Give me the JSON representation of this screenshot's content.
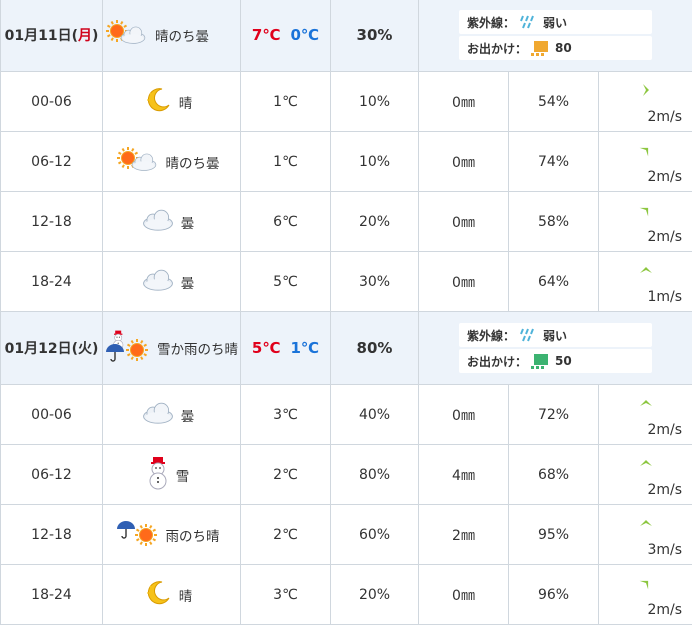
{
  "days": [
    {
      "date": "01月11日",
      "weekday": "月",
      "weather_icon": "sun-then-cloud-icon",
      "weather_text": "晴のち曇",
      "temp_max": "7℃",
      "temp_min": "0℃",
      "precip": "30%",
      "uv_label": "紫外線：",
      "uv_value": "弱い",
      "outing_label": "お出かけ：",
      "outing_value": "80",
      "hours": [
        {
          "time": "00-06",
          "icon": "moon-icon",
          "weather": "晴",
          "temp": "1℃",
          "precip": "10%",
          "rain": "0㎜",
          "humidity": "54%",
          "wind": "2m/s",
          "wind_dir": "west"
        },
        {
          "time": "06-12",
          "icon": "sun-then-cloud-icon",
          "weather": "晴のち曇",
          "temp": "1℃",
          "precip": "10%",
          "rain": "0㎜",
          "humidity": "74%",
          "wind": "2m/s",
          "wind_dir": "northeast"
        },
        {
          "time": "12-18",
          "icon": "cloud-icon",
          "weather": "曇",
          "temp": "6℃",
          "precip": "20%",
          "rain": "0㎜",
          "humidity": "58%",
          "wind": "2m/s",
          "wind_dir": "northeast"
        },
        {
          "time": "18-24",
          "icon": "cloud-icon",
          "weather": "曇",
          "temp": "5℃",
          "precip": "30%",
          "rain": "0㎜",
          "humidity": "64%",
          "wind": "1m/s",
          "wind_dir": "north"
        }
      ]
    },
    {
      "date": "01月12日",
      "weekday": "火",
      "weather_icon": "snow-or-rain-then-sun-icon",
      "weather_text": "雪か雨のち晴",
      "temp_max": "5℃",
      "temp_min": "1℃",
      "precip": "80%",
      "uv_label": "紫外線：",
      "uv_value": "弱い",
      "outing_label": "お出かけ：",
      "outing_value": "50",
      "hours": [
        {
          "time": "00-06",
          "icon": "cloud-icon",
          "weather": "曇",
          "temp": "3℃",
          "precip": "40%",
          "rain": "0㎜",
          "humidity": "72%",
          "wind": "2m/s",
          "wind_dir": "north"
        },
        {
          "time": "06-12",
          "icon": "snowman-icon",
          "weather": "雪",
          "temp": "2℃",
          "precip": "80%",
          "rain": "4㎜",
          "humidity": "68%",
          "wind": "2m/s",
          "wind_dir": "north"
        },
        {
          "time": "12-18",
          "icon": "umbrella-then-sun-icon",
          "weather": "雨のち晴",
          "temp": "2℃",
          "precip": "60%",
          "rain": "2㎜",
          "humidity": "95%",
          "wind": "3m/s",
          "wind_dir": "north"
        },
        {
          "time": "18-24",
          "icon": "moon-icon",
          "weather": "晴",
          "temp": "3℃",
          "precip": "20%",
          "rain": "0㎜",
          "humidity": "96%",
          "wind": "2m/s",
          "wind_dir": "northeast"
        }
      ]
    }
  ],
  "colors": {
    "accent_red": "#e0001b",
    "accent_blue": "#1a73d9",
    "header_bg": "#edf3fa",
    "grid": "#d0d7de",
    "wind_arrow": "#8cc63f"
  }
}
